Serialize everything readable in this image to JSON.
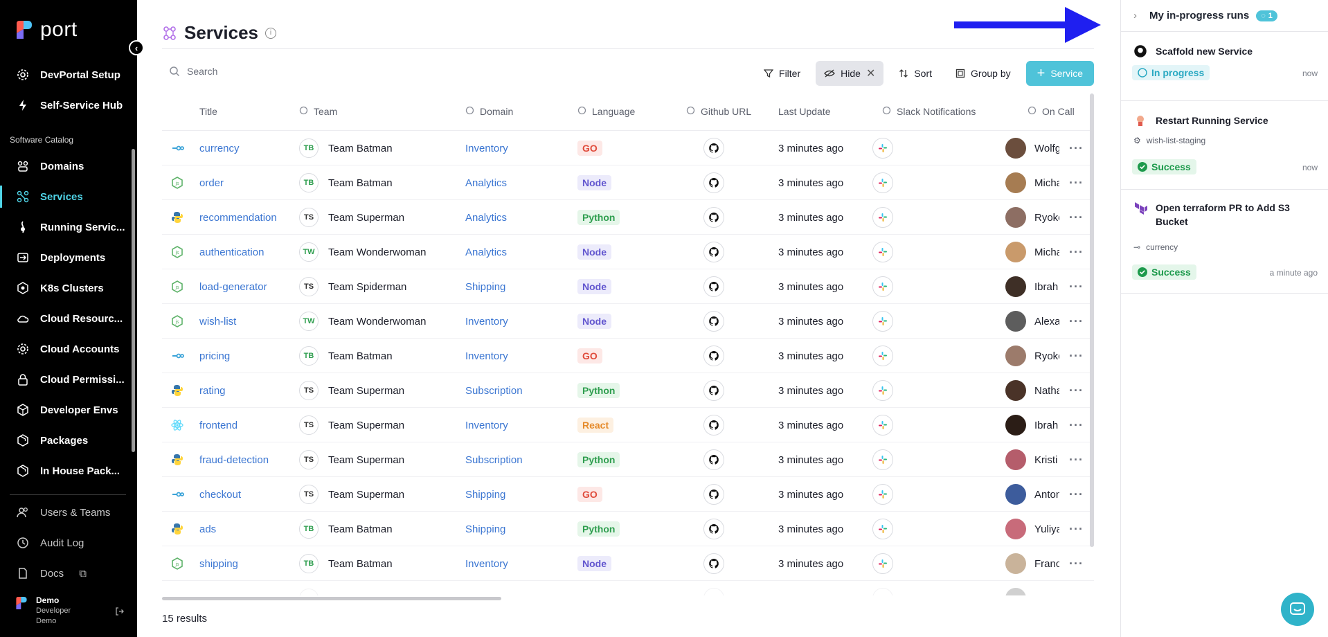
{
  "brand": {
    "name": "port"
  },
  "sidebar": {
    "top_items": [
      {
        "label": "DevPortal Setup",
        "icon": "gear-icon"
      },
      {
        "label": "Self-Service Hub",
        "icon": "bolt-icon"
      }
    ],
    "section_label": "Software Catalog",
    "catalog_items": [
      {
        "label": "Domains",
        "icon": "domains-icon"
      },
      {
        "label": "Services",
        "icon": "services-icon",
        "active": true
      },
      {
        "label": "Running Servic...",
        "icon": "running-icon"
      },
      {
        "label": "Deployments",
        "icon": "deployments-icon"
      },
      {
        "label": "K8s Clusters",
        "icon": "k8s-icon"
      },
      {
        "label": "Cloud Resourc...",
        "icon": "cloud-icon"
      },
      {
        "label": "Cloud Accounts",
        "icon": "gear-icon"
      },
      {
        "label": "Cloud Permissi...",
        "icon": "lock-icon"
      },
      {
        "label": "Developer Envs",
        "icon": "cube-icon"
      },
      {
        "label": "Packages",
        "icon": "package-icon"
      },
      {
        "label": "In House Pack...",
        "icon": "package-icon"
      }
    ],
    "bottom_items": [
      {
        "label": "Users & Teams",
        "icon": "users-icon"
      },
      {
        "label": "Audit Log",
        "icon": "history-icon"
      },
      {
        "label": "Docs",
        "icon": "doc-icon"
      }
    ],
    "user": {
      "name": "Demo",
      "role": "Developer",
      "org": "Demo"
    }
  },
  "page": {
    "title": "Services",
    "search_placeholder": "Search",
    "toolbar": {
      "filter": "Filter",
      "hide": "Hide",
      "sort": "Sort",
      "group_by": "Group by",
      "add": "Service"
    },
    "columns": [
      "Title",
      "Team",
      "Domain",
      "Language",
      "Github URL",
      "Last Update",
      "Slack Notifications",
      "On Call"
    ],
    "results": "15 results"
  },
  "rows": [
    {
      "title": "currency",
      "icon": "go",
      "team_abbr": "TB",
      "team": "Team Batman",
      "domain": "Inventory",
      "lang": "GO",
      "updated": "3 minutes ago",
      "oncall": "Wolfg"
    },
    {
      "title": "order",
      "icon": "node",
      "team_abbr": "TB",
      "team": "Team Batman",
      "domain": "Analytics",
      "lang": "Node",
      "updated": "3 minutes ago",
      "oncall": "Micha"
    },
    {
      "title": "recommendation",
      "icon": "python",
      "team_abbr": "TS",
      "team": "Team Superman",
      "domain": "Analytics",
      "lang": "Python",
      "updated": "3 minutes ago",
      "oncall": "Ryoko"
    },
    {
      "title": "authentication",
      "icon": "node",
      "team_abbr": "TW",
      "team": "Team Wonderwoman",
      "domain": "Analytics",
      "lang": "Node",
      "updated": "3 minutes ago",
      "oncall": "Micha"
    },
    {
      "title": "load-generator",
      "icon": "node",
      "team_abbr": "TS",
      "team": "Team Spiderman",
      "domain": "Shipping",
      "lang": "Node",
      "updated": "3 minutes ago",
      "oncall": "Ibrah"
    },
    {
      "title": "wish-list",
      "icon": "node",
      "team_abbr": "TW",
      "team": "Team Wonderwoman",
      "domain": "Inventory",
      "lang": "Node",
      "updated": "3 minutes ago",
      "oncall": "Alexa"
    },
    {
      "title": "pricing",
      "icon": "go",
      "team_abbr": "TB",
      "team": "Team Batman",
      "domain": "Inventory",
      "lang": "GO",
      "updated": "3 minutes ago",
      "oncall": "Ryoko"
    },
    {
      "title": "rating",
      "icon": "python",
      "team_abbr": "TS",
      "team": "Team Superman",
      "domain": "Subscription",
      "lang": "Python",
      "updated": "3 minutes ago",
      "oncall": "Natha"
    },
    {
      "title": "frontend",
      "icon": "react",
      "team_abbr": "TS",
      "team": "Team Superman",
      "domain": "Inventory",
      "lang": "React",
      "updated": "3 minutes ago",
      "oncall": "Ibrah"
    },
    {
      "title": "fraud-detection",
      "icon": "python",
      "team_abbr": "TS",
      "team": "Team Superman",
      "domain": "Subscription",
      "lang": "Python",
      "updated": "3 minutes ago",
      "oncall": "Kristi"
    },
    {
      "title": "checkout",
      "icon": "go",
      "team_abbr": "TS",
      "team": "Team Superman",
      "domain": "Shipping",
      "lang": "GO",
      "updated": "3 minutes ago",
      "oncall": "Anton"
    },
    {
      "title": "ads",
      "icon": "python",
      "team_abbr": "TB",
      "team": "Team Batman",
      "domain": "Shipping",
      "lang": "Python",
      "updated": "3 minutes ago",
      "oncall": "Yuliya"
    },
    {
      "title": "shipping",
      "icon": "node",
      "team_abbr": "TB",
      "team": "Team Batman",
      "domain": "Inventory",
      "lang": "Node",
      "updated": "3 minutes ago",
      "oncall": "Franc"
    }
  ],
  "lang_colors": {
    "GO": {
      "bg": "#fde8e6",
      "fg": "#e04b3b"
    },
    "Node": {
      "bg": "#ecebfb",
      "fg": "#6256cf"
    },
    "Python": {
      "bg": "#e5f6e9",
      "fg": "#2f9e4f"
    },
    "React": {
      "bg": "#fdf0e1",
      "fg": "#e58a2a"
    }
  },
  "team_colors": {
    "TB": "#2f9e4f",
    "TS": "#333333",
    "TW": "#2f9e4f"
  },
  "runs_panel": {
    "title": "My in-progress runs",
    "count": "1",
    "runs": [
      {
        "title": "Scaffold new Service",
        "icon": "github-icon",
        "status": "In progress",
        "time": "now"
      },
      {
        "title": "Restart Running Service",
        "icon": "restart-icon",
        "entity": "wish-list-staging",
        "status": "Success",
        "time": "now"
      },
      {
        "title": "Open terraform PR to Add S3 Bucket",
        "icon": "terraform-icon",
        "entity": "currency",
        "status": "Success",
        "time": "a minute ago"
      }
    ]
  }
}
